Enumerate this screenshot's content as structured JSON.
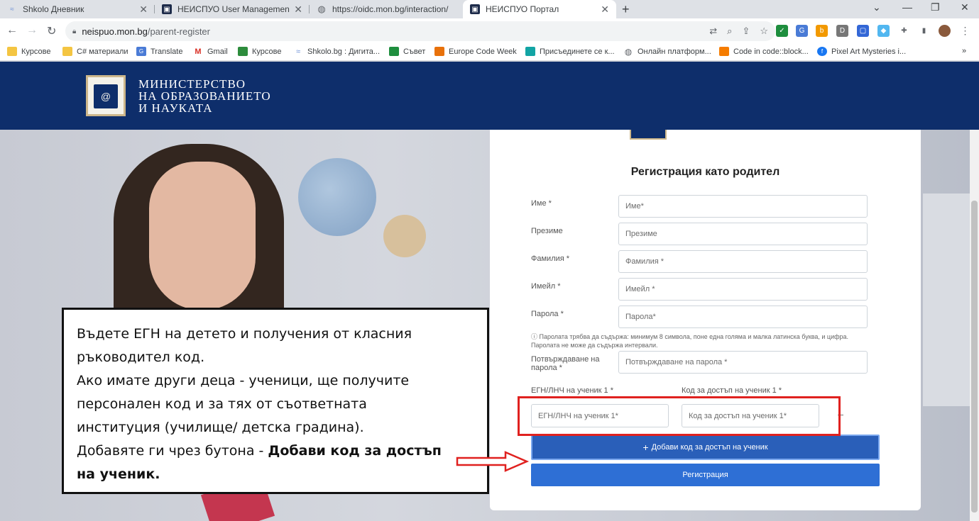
{
  "browser": {
    "tabs": [
      {
        "title": "Shkolo Дневник",
        "icon": "shkolo-icon",
        "active": false
      },
      {
        "title": "НЕИСПУО User Management",
        "icon": "neispuo-icon",
        "active": false
      },
      {
        "title": "https://oidc.mon.bg/interaction/",
        "icon": "globe-icon",
        "active": false
      },
      {
        "title": "НЕИСПУО Портал",
        "icon": "neispuo-icon",
        "active": true
      }
    ],
    "address": {
      "host": "neispuo.mon.bg",
      "path": "/parent-register"
    },
    "bookmarks": [
      "Курсове",
      "C# материали",
      "Translate",
      "Gmail",
      "Курсове",
      "Shkolo.bg : Дигита...",
      "Съвет",
      "Europe Code Week",
      "Присъединете се к...",
      "Онлайн платформ...",
      "Code in code::block...",
      "Pixel Art Mysteries i..."
    ],
    "more": "»"
  },
  "header": {
    "line1": "МИНИСТЕРСТВО",
    "line2": "НА ОБРАЗОВАНИЕТО",
    "line3": "И НАУКАТА"
  },
  "form": {
    "title": "Регистрация като родител",
    "first_name": {
      "label": "Име *",
      "placeholder": "Име*"
    },
    "middle_name": {
      "label": "Презиме",
      "placeholder": "Презиме"
    },
    "last_name": {
      "label": "Фамилия *",
      "placeholder": "Фамилия *"
    },
    "email": {
      "label": "Имейл *",
      "placeholder": "Имейл *"
    },
    "password": {
      "label": "Парола *",
      "placeholder": "Парола*"
    },
    "password_hint": "Паролата трябва да съдържа: минимум 8 символа, поне една голяма и малка латинска буква, и цифра. Паролата не може да съдържа интервали.",
    "confirm_password": {
      "label": "Потвърждаване на парола *",
      "placeholder": "Потвърждаване на парола *"
    },
    "student_id": {
      "label": "ЕГН/ЛНЧ на ученик 1 *",
      "placeholder": "ЕГН/ЛНЧ на ученик 1*"
    },
    "access_code": {
      "label": "Код за достъп на ученик 1 *",
      "placeholder": "Код за достъп на ученик 1*"
    },
    "add_code_button": "Добави код за достъп на ученик",
    "register_button": "Регистрация"
  },
  "callout": {
    "line1": "Въдете ЕГН на детето и получения от класния",
    "line2": "ръководител код.",
    "line3": "Ако имате други деца - ученици, ще получите",
    "line4": "персонален код и за тях от съответната",
    "line5": "институция (училище/ детска градина).",
    "line6_plain": "Добавяте ги чрез бутона - ",
    "line6_bold": "Добави код за достъп",
    "line7_bold": "на ученик",
    "line7_tail": "."
  },
  "colors": {
    "header_bg": "#0e2e6b",
    "primary_button": "#2e6fd5",
    "highlight_red": "#e0211f"
  }
}
